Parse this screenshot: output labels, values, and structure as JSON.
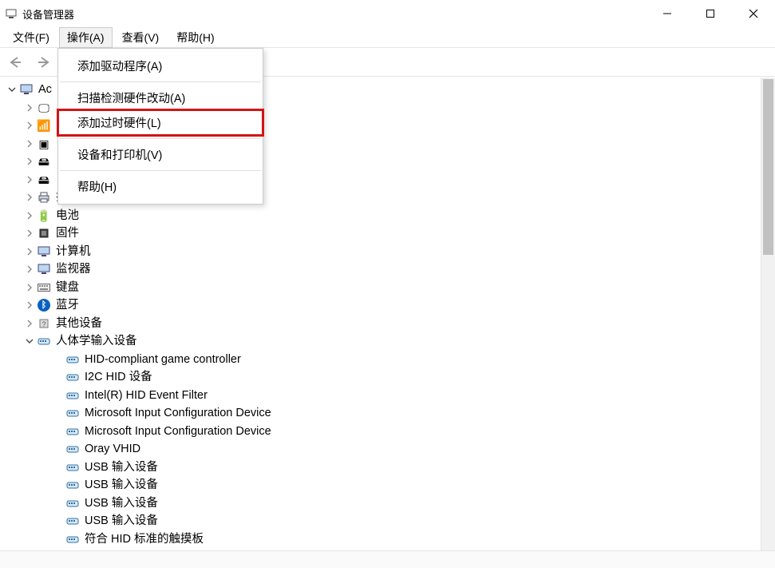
{
  "window": {
    "title": "设备管理器"
  },
  "menubar": {
    "items": [
      {
        "label": "文件(F)"
      },
      {
        "label": "操作(A)"
      },
      {
        "label": "查看(V)"
      },
      {
        "label": "帮助(H)"
      }
    ]
  },
  "dropdown": {
    "items": [
      {
        "label": "添加驱动程序(A)",
        "sep_after": true
      },
      {
        "label": "扫描检测硬件改动(A)",
        "sep_after": false
      },
      {
        "label": "添加过时硬件(L)",
        "sep_after": true,
        "highlighted": true
      },
      {
        "label": "设备和打印机(V)",
        "sep_after": true
      },
      {
        "label": "帮助(H)",
        "sep_after": false
      }
    ]
  },
  "tree": {
    "root": {
      "label": "Ac",
      "icon": "computer-icon"
    },
    "categories_top_hidden": [
      {
        "label": "",
        "icon": "display-icon"
      },
      {
        "label": "",
        "icon": "device-icon"
      },
      {
        "label": "",
        "icon": "cpu-icon"
      },
      {
        "label": "",
        "icon": "disk-icon"
      },
      {
        "label": "",
        "icon": "controller-icon"
      }
    ],
    "categories": [
      {
        "label": "打印队列",
        "icon": "printer-icon"
      },
      {
        "label": "电池",
        "icon": "battery-icon"
      },
      {
        "label": "固件",
        "icon": "firmware-icon"
      },
      {
        "label": "计算机",
        "icon": "computer-icon"
      },
      {
        "label": "监视器",
        "icon": "monitor-icon"
      },
      {
        "label": "键盘",
        "icon": "keyboard-icon"
      },
      {
        "label": "蓝牙",
        "icon": "bluetooth-icon"
      },
      {
        "label": "其他设备",
        "icon": "other-icon"
      }
    ],
    "expanded_category": {
      "label": "人体学输入设备",
      "icon": "hid-icon",
      "children": [
        {
          "label": "HID-compliant game controller",
          "icon": "hid-dev-icon"
        },
        {
          "label": "I2C HID 设备",
          "icon": "hid-dev-icon"
        },
        {
          "label": "Intel(R) HID Event Filter",
          "icon": "hid-dev-icon"
        },
        {
          "label": "Microsoft Input Configuration Device",
          "icon": "hid-dev-icon"
        },
        {
          "label": "Microsoft Input Configuration Device",
          "icon": "hid-dev-icon"
        },
        {
          "label": "Oray VHID",
          "icon": "hid-dev-icon"
        },
        {
          "label": "USB 输入设备",
          "icon": "hid-dev-icon"
        },
        {
          "label": "USB 输入设备",
          "icon": "hid-dev-icon"
        },
        {
          "label": "USB 输入设备",
          "icon": "hid-dev-icon"
        },
        {
          "label": "USB 输入设备",
          "icon": "hid-dev-icon"
        },
        {
          "label": "符合 HID 标准的触摸板",
          "icon": "hid-dev-icon"
        }
      ]
    }
  },
  "icons": {
    "computer-icon": "🖥",
    "display-icon": "🖵",
    "device-icon": "📶",
    "cpu-icon": "▣",
    "disk-icon": "🖴",
    "controller-icon": "🖴",
    "printer-icon": "🖶",
    "battery-icon": "🔋",
    "firmware-icon": "▤",
    "monitor-icon": "🖵",
    "keyboard-icon": "⌨",
    "bluetooth-icon": "ᛒ",
    "other-icon": "❓",
    "hid-icon": "🖰",
    "hid-dev-icon": "🖰"
  }
}
